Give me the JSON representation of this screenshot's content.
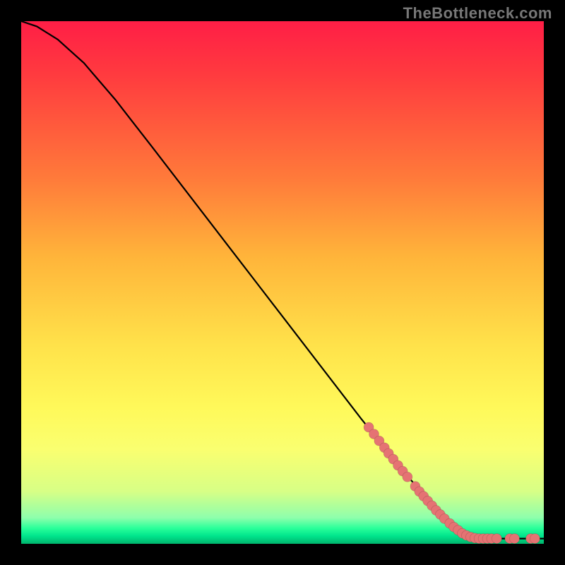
{
  "watermark": "TheBottleneck.com",
  "chart_data": {
    "type": "line",
    "title": "",
    "xlabel": "",
    "ylabel": "",
    "xlim": [
      0,
      100
    ],
    "ylim": [
      0,
      100
    ],
    "grid": false,
    "legend": false,
    "curve": [
      {
        "x": 0,
        "y": 100
      },
      {
        "x": 3,
        "y": 99
      },
      {
        "x": 7,
        "y": 96.5
      },
      {
        "x": 12,
        "y": 92
      },
      {
        "x": 18,
        "y": 85
      },
      {
        "x": 25,
        "y": 76
      },
      {
        "x": 35,
        "y": 63
      },
      {
        "x": 45,
        "y": 50
      },
      {
        "x": 55,
        "y": 37
      },
      {
        "x": 65,
        "y": 24
      },
      {
        "x": 73,
        "y": 14
      },
      {
        "x": 80,
        "y": 6
      },
      {
        "x": 84,
        "y": 2.5
      },
      {
        "x": 86,
        "y": 1.3
      },
      {
        "x": 88,
        "y": 1.0
      },
      {
        "x": 92,
        "y": 1.0
      },
      {
        "x": 96,
        "y": 1.0
      },
      {
        "x": 100,
        "y": 1.0
      }
    ],
    "markers": [
      {
        "x": 66.5,
        "y": 22.3
      },
      {
        "x": 67.5,
        "y": 21.0
      },
      {
        "x": 68.5,
        "y": 19.7
      },
      {
        "x": 69.5,
        "y": 18.4
      },
      {
        "x": 70.3,
        "y": 17.3
      },
      {
        "x": 71.2,
        "y": 16.2
      },
      {
        "x": 72.1,
        "y": 15.0
      },
      {
        "x": 73.0,
        "y": 13.9
      },
      {
        "x": 73.9,
        "y": 12.8
      },
      {
        "x": 75.4,
        "y": 11.0
      },
      {
        "x": 76.2,
        "y": 10.0
      },
      {
        "x": 77.0,
        "y": 9.1
      },
      {
        "x": 77.8,
        "y": 8.2
      },
      {
        "x": 78.6,
        "y": 7.3
      },
      {
        "x": 79.4,
        "y": 6.4
      },
      {
        "x": 80.2,
        "y": 5.6
      },
      {
        "x": 81.0,
        "y": 4.8
      },
      {
        "x": 82.0,
        "y": 3.9
      },
      {
        "x": 82.8,
        "y": 3.2
      },
      {
        "x": 83.6,
        "y": 2.6
      },
      {
        "x": 84.4,
        "y": 2.0
      },
      {
        "x": 85.2,
        "y": 1.6
      },
      {
        "x": 86.0,
        "y": 1.3
      },
      {
        "x": 86.8,
        "y": 1.1
      },
      {
        "x": 87.6,
        "y": 1.0
      },
      {
        "x": 88.4,
        "y": 1.0
      },
      {
        "x": 89.2,
        "y": 1.0
      },
      {
        "x": 90.0,
        "y": 1.0
      },
      {
        "x": 91.0,
        "y": 1.0
      },
      {
        "x": 93.5,
        "y": 1.0
      },
      {
        "x": 94.4,
        "y": 1.0
      },
      {
        "x": 97.5,
        "y": 1.0
      },
      {
        "x": 98.3,
        "y": 1.0
      }
    ],
    "marker_color": "#e57373",
    "marker_radius": 7
  }
}
